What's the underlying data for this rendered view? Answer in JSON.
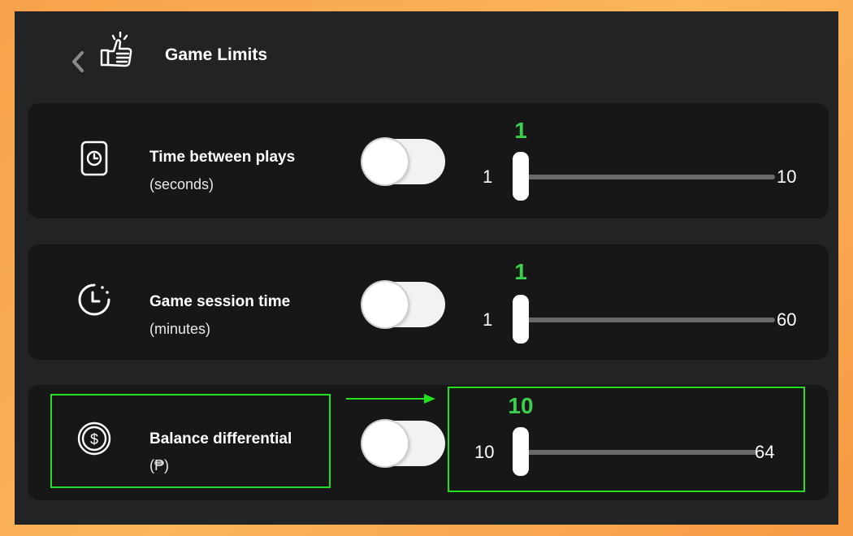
{
  "header": {
    "title": "Game Limits",
    "back_icon": "chevron-left-icon",
    "header_icon": "thumbs-up-icon"
  },
  "limits": [
    {
      "title": "Time between plays",
      "subtitle": "(seconds)",
      "icon": "clock-card-icon",
      "toggle_on": false,
      "value": "1",
      "min": "1",
      "max": "10"
    },
    {
      "title": "Game session time",
      "subtitle": "(minutes)",
      "icon": "timer-icon",
      "toggle_on": false,
      "value": "1",
      "min": "1",
      "max": "60"
    },
    {
      "title": "Balance differential",
      "subtitle": "(₱)",
      "icon": "dollar-coin-icon",
      "toggle_on": false,
      "value": "10",
      "min": "10",
      "max": "64"
    }
  ],
  "colors": {
    "accent_green": "#3ccf4e",
    "highlight_green": "#22e020",
    "card_bg": "#171717",
    "panel_bg": "#222325"
  }
}
